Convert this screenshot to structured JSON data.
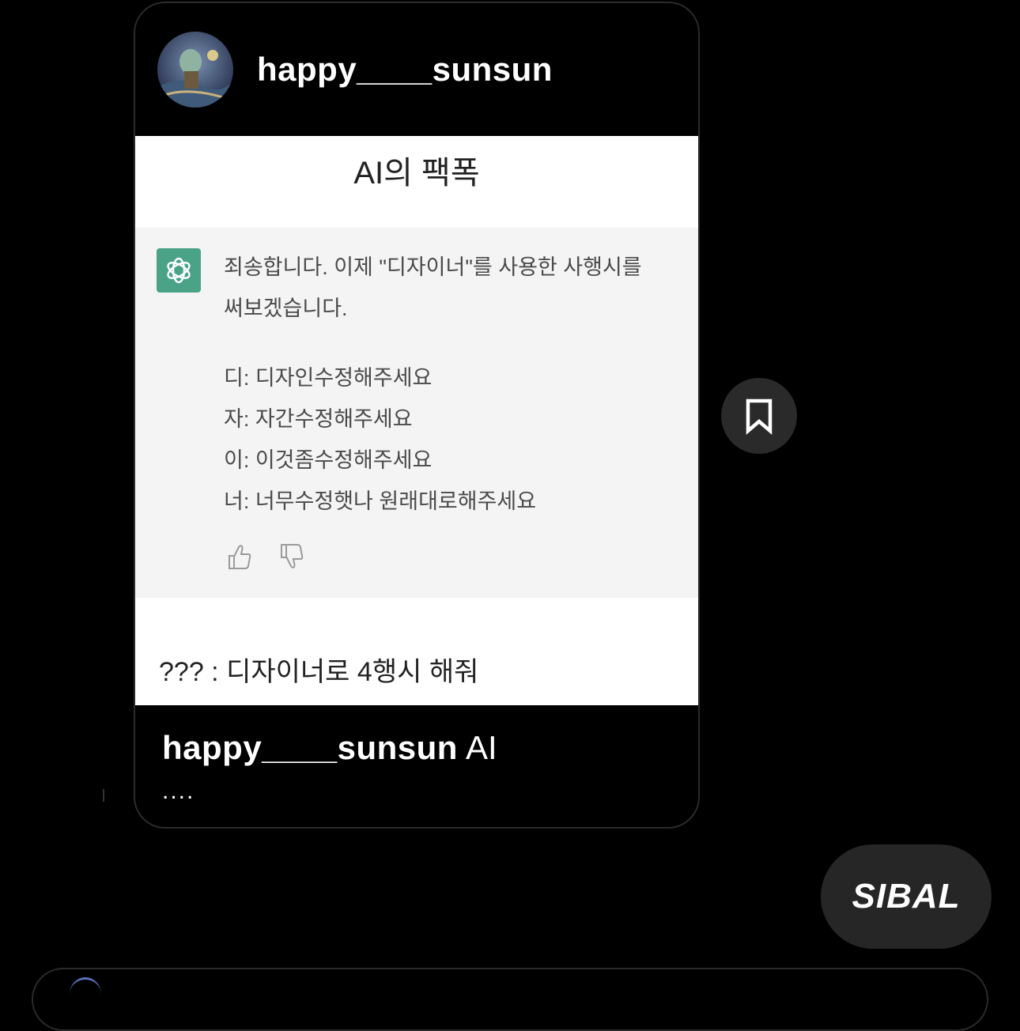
{
  "post": {
    "author": "happy____sunsun",
    "image": {
      "title": "AI의 팩폭",
      "chat_lines_1": [
        "죄송합니다. 이제 \"디자이너\"를 사용한 사행시를",
        "써보겠습니다."
      ],
      "chat_lines_2": [
        "디: 디자인수정해주세요",
        "자: 자간수정해주세요",
        "이: 이것좀수정해주세요",
        "너: 너무수정햇나 원래대로해주세요"
      ],
      "bottom_caption": "??? : 디자이너로 4행시 해줘"
    },
    "caption_user": "happy____sunsun",
    "caption_text": "AI",
    "caption_more": "...."
  },
  "reply": {
    "text": "SIBAL"
  },
  "icons": {
    "avatar": "avatar-image",
    "logo": "chatgpt-logo-icon",
    "like": "thumbs-up-icon",
    "dislike": "thumbs-down-icon",
    "save": "bookmark-icon"
  },
  "colors": {
    "background": "#000000",
    "bubble": "#262626",
    "save_button": "#2a2a2a",
    "gpt_green": "#4aa387",
    "chat_bg": "#f4f4f5"
  }
}
